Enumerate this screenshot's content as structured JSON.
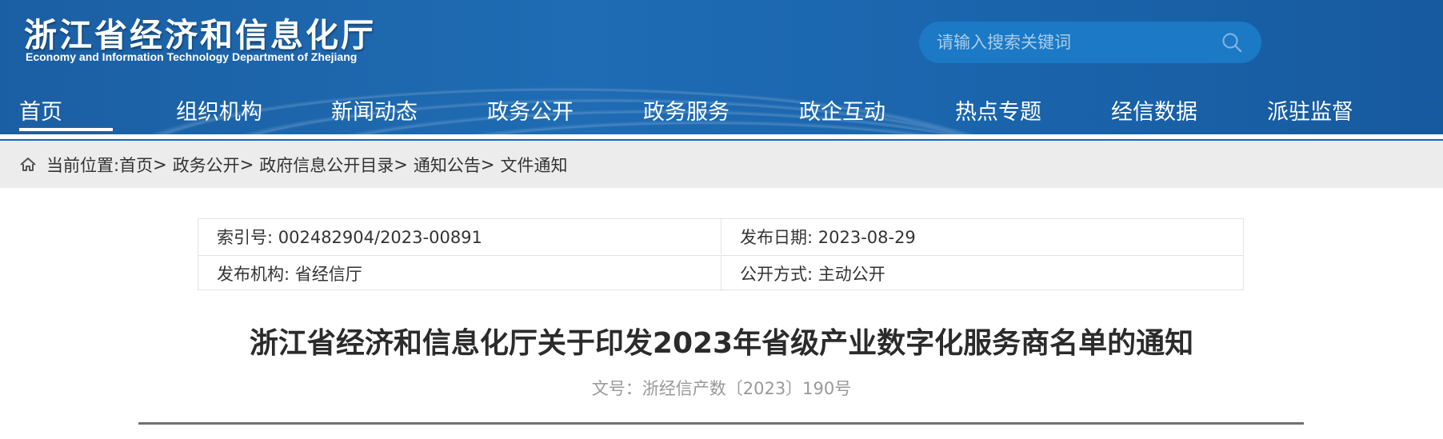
{
  "header": {
    "logo_cn": "浙江省经济和信息化厅",
    "logo_en": "Economy and Information Technology Department of Zhejiang",
    "search": {
      "placeholder": "请输入搜索关键词"
    }
  },
  "nav": {
    "items": [
      {
        "label": "首页",
        "active": true
      },
      {
        "label": "组织机构"
      },
      {
        "label": "新闻动态"
      },
      {
        "label": "政务公开"
      },
      {
        "label": "政务服务"
      },
      {
        "label": "政企互动"
      },
      {
        "label": "热点专题"
      },
      {
        "label": "经信数据"
      },
      {
        "label": "派驻监督"
      }
    ]
  },
  "breadcrumb": {
    "label": "当前位置:",
    "items": [
      "首页",
      "政务公开",
      "政府信息公开目录",
      "通知公告",
      "文件通知"
    ],
    "separator": ">"
  },
  "meta": {
    "index_no": "索引号: 002482904/2023-00891",
    "publish_date": "发布日期: 2023-08-29",
    "publisher": "发布机构: 省经信厅",
    "disclosure": "公开方式: 主动公开"
  },
  "document": {
    "title": "浙江省经济和信息化厅关于印发2023年省级产业数字化服务商名单的通知",
    "number": "文号：浙经信产数〔2023〕190号"
  },
  "colors": {
    "header_bg": "#1b5fa3",
    "search_bg": "#1b79c6",
    "breadcrumb_bg": "#ececec",
    "divider": "#707070"
  }
}
